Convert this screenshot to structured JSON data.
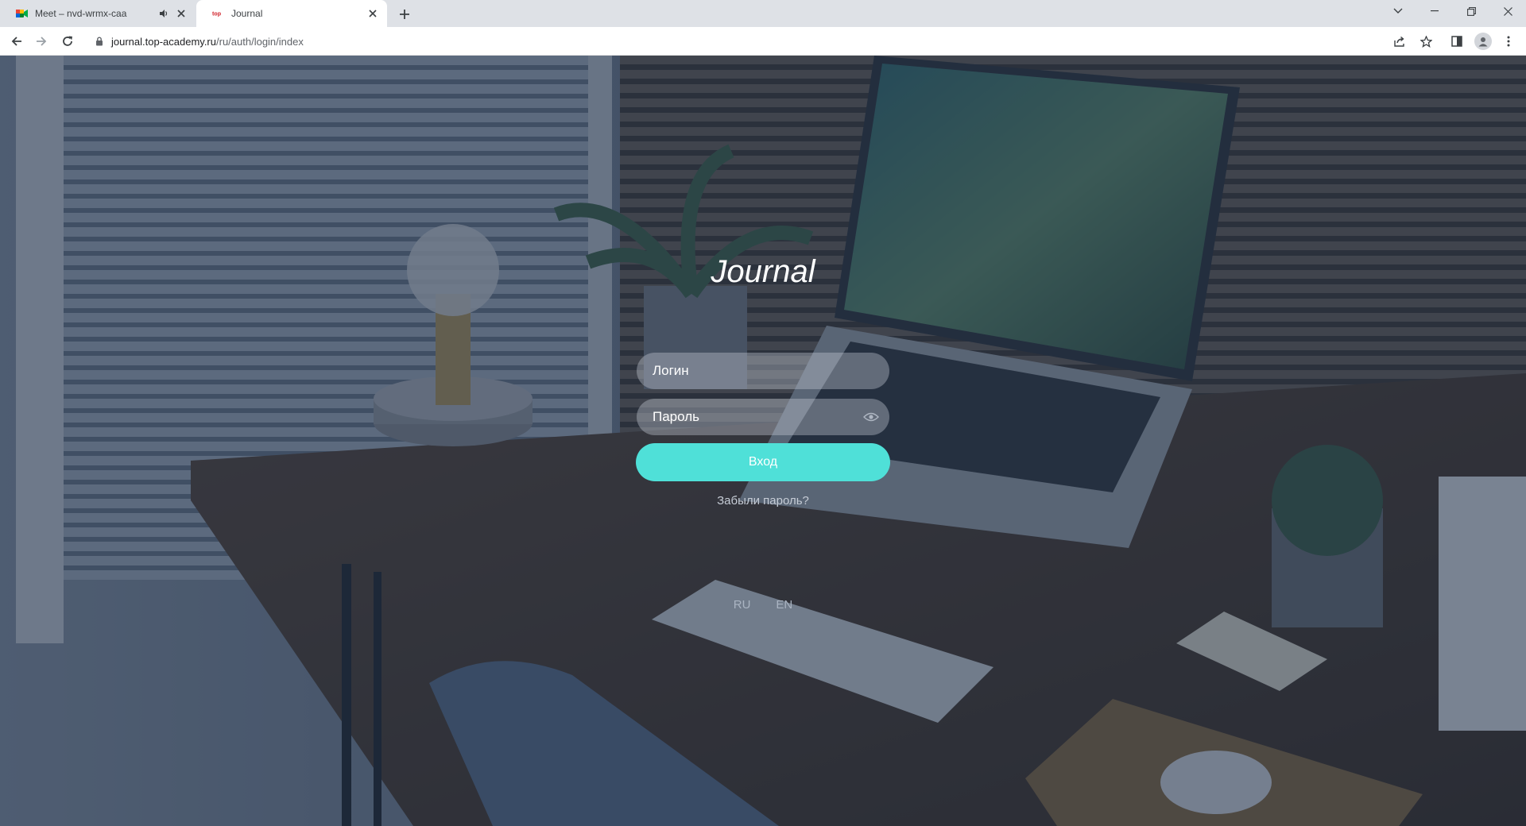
{
  "browser": {
    "tabs": [
      {
        "title": "Meet – nvd-wrmx-caa",
        "icon": "google-meet-icon",
        "audio": true
      },
      {
        "title": "Journal",
        "icon": "top-academy-icon",
        "active": true
      }
    ],
    "url_host": "journal.top-academy.ru",
    "url_path": "/ru/auth/login/index"
  },
  "login": {
    "brand": "Journal",
    "login_placeholder": "Логин",
    "password_placeholder": "Пароль",
    "submit_label": "Вход",
    "forgot_label": "Забыли пароль?",
    "languages": [
      "RU",
      "EN"
    ]
  },
  "colors": {
    "accent_button": "#4fe0d8",
    "overlay": "rgba(30,45,70,0.55)"
  }
}
